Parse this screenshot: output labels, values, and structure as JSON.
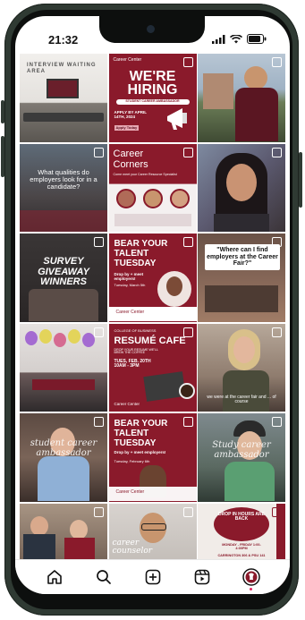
{
  "status": {
    "time": "21:32"
  },
  "tiles": [
    {
      "top": "INTERVIEW WAITING AREA",
      "main": ""
    },
    {
      "top": "Career Center",
      "main": "WE'RE HIRING",
      "sub": "STUDENT CAREER AMBASSADOR",
      "date": "APPLY BY APRIL 14TH, 2024",
      "cta": "Apply Today"
    },
    {
      "top": "",
      "main": ""
    },
    {
      "top": "",
      "main": "What qualities do employers look for in a candidate?"
    },
    {
      "top": "",
      "main": "Career Corners",
      "sub": "Come meet your Career Resource Specialist"
    },
    {
      "top": "",
      "main": ""
    },
    {
      "top": "",
      "main": "SURVEY GIVEAWAY WINNERS"
    },
    {
      "top": "",
      "main": "BEAR YOUR TALENT TUESDAY",
      "sub": "Drop by + meet employers!",
      "date": "Tuesday, March 5th",
      "brand": "Career Center"
    },
    {
      "top": "",
      "main": "\"Where can I find employers at the Career Fair?\""
    },
    {
      "top": "",
      "main": ""
    },
    {
      "top": "COLLEGE OF BUSINESS",
      "main": "RESUMÉ CAFE",
      "sub": "DROP YOUR RESUME WE'LL BREW THE COFFEE",
      "date": "TUES, FEB. 20TH 10AM - 3PM",
      "brand": "Career Center"
    },
    {
      "top": "",
      "main": "",
      "sub": "we were at the career fair and ... of course"
    },
    {
      "top": "",
      "main": "student career ambassador"
    },
    {
      "top": "",
      "main": "BEAR YOUR TALENT TUESDAY",
      "sub": "Drop by + meet employers!",
      "date": "Tuesday, February 6th",
      "brand": "Career Center"
    },
    {
      "top": "",
      "main": "Study career ambassador"
    },
    {
      "top": "",
      "main": ""
    },
    {
      "top": "",
      "main": "career counselor"
    },
    {
      "top": "",
      "main": "DROP IN HOURS ARE BACK",
      "sub": "MONDAY - FRIDAY 1:00-4:00PM",
      "date": "CARRINGTON 306 & PSU 141"
    }
  ],
  "nav": [
    "home-icon",
    "search-icon",
    "create-icon",
    "reels-icon",
    "profile-icon"
  ],
  "colors": {
    "maroon": "#8a1a2b",
    "frame": "#2f3a33"
  }
}
